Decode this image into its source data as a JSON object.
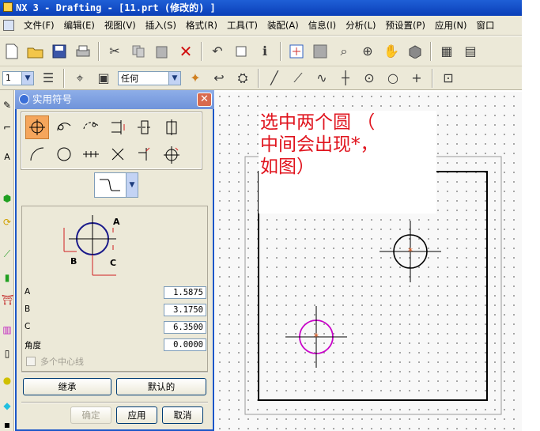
{
  "window": {
    "title": "NX 3 - Drafting - [11.prt  (修改的) ]"
  },
  "menu": {
    "items": [
      {
        "label": "文件(F)"
      },
      {
        "label": "编辑(E)"
      },
      {
        "label": "视图(V)"
      },
      {
        "label": "插入(S)"
      },
      {
        "label": "格式(R)"
      },
      {
        "label": "工具(T)"
      },
      {
        "label": "装配(A)"
      },
      {
        "label": "信息(I)"
      },
      {
        "label": "分析(L)"
      },
      {
        "label": "预设置(P)"
      },
      {
        "label": "应用(N)"
      },
      {
        "label": "窗口"
      }
    ]
  },
  "toolbar2": {
    "layer_value": "1",
    "filter_value": "任何"
  },
  "dialog": {
    "title": "实用符号",
    "close_glyph": "✕",
    "params": [
      {
        "label": "A",
        "value": "1.5875"
      },
      {
        "label": "B",
        "value": "3.1750"
      },
      {
        "label": "C",
        "value": "6.3500"
      },
      {
        "label": "角度",
        "value": "0.0000"
      }
    ],
    "multi_centerline": {
      "label": "多个中心线",
      "checked": false,
      "enabled": false
    },
    "inherit_button": "继承",
    "default_button": "默认的",
    "ok_button": "确定",
    "apply_button": "应用",
    "cancel_button": "取消",
    "preview_labels": {
      "a": "A",
      "b": "B",
      "c": "C"
    }
  },
  "annotation": {
    "lines": [
      "选中两个圆 （",
      "中间会出现*，",
      "如图）"
    ],
    "color": "#e0141e"
  },
  "colors": {
    "title_bar": "#0b3fb8",
    "dialog_title": "#6f93da",
    "selected_circle": "#c800c8",
    "center_mark": "#e05010",
    "active_symbol_bg": "#f5a65c"
  }
}
